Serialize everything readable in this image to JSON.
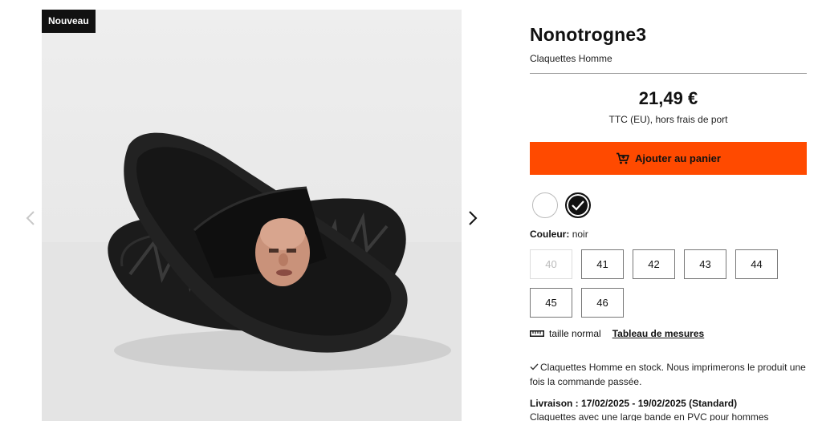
{
  "gallery": {
    "badge": "Nouveau",
    "image_alt": "Claquettes noires avec visage imprimé",
    "prev_icon": "chevron-left-icon",
    "next_icon": "chevron-right-icon"
  },
  "product": {
    "title": "Nonotrogne3",
    "subtitle": "Claquettes Homme",
    "price": "21,49 €",
    "tax_note": "TTC (EU), hors frais de port",
    "cart_button": "Ajouter au panier",
    "cart_icon": "cart-icon",
    "colors": [
      {
        "name": "blanc",
        "hex": "#ffffff",
        "selected": false
      },
      {
        "name": "noir",
        "hex": "#111111",
        "selected": true
      }
    ],
    "color_label": "Couleur:",
    "color_value": "noir",
    "sizes": [
      {
        "label": "40",
        "available": false
      },
      {
        "label": "41",
        "available": true
      },
      {
        "label": "42",
        "available": true
      },
      {
        "label": "43",
        "available": true
      },
      {
        "label": "44",
        "available": true
      },
      {
        "label": "45",
        "available": true
      },
      {
        "label": "46",
        "available": true
      }
    ],
    "fit_icon": "ruler-icon",
    "fit_text": "taille normal",
    "size_chart_link": "Tableau de mesures",
    "stock_icon": "check-icon",
    "stock_text": "Claquettes Homme en stock. Nous imprimerons le produit une fois la commande passée.",
    "delivery": "Livraison : 17/02/2025 - 19/02/2025 (Standard)",
    "description": "Claquettes avec une large bande en PVC pour hommes"
  },
  "colors": {
    "accent": "#ff4a00",
    "text": "#111111",
    "divider": "#9a9a9a"
  }
}
